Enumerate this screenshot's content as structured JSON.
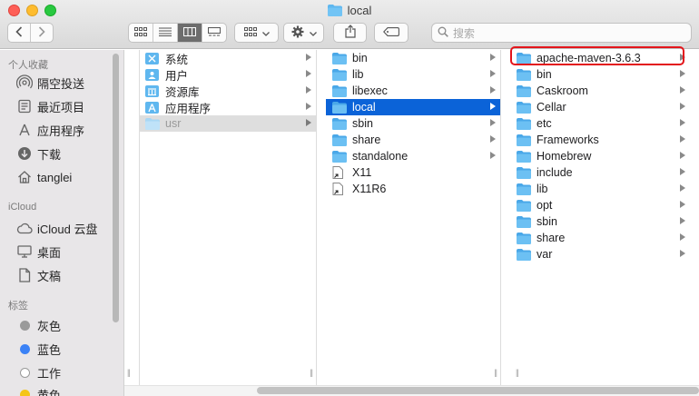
{
  "window": {
    "title": "local"
  },
  "toolbar": {
    "view_modes": [
      "icon-view",
      "list-view",
      "column-view",
      "gallery-view"
    ],
    "active_view": "column-view",
    "search_placeholder": "搜索"
  },
  "sidebar": {
    "sections": [
      {
        "heading": "个人收藏",
        "items": [
          {
            "label": "隔空投送",
            "icon": "airdrop-icon"
          },
          {
            "label": "最近项目",
            "icon": "recents-icon"
          },
          {
            "label": "应用程序",
            "icon": "applications-icon"
          },
          {
            "label": "下载",
            "icon": "downloads-icon"
          },
          {
            "label": "tanglei",
            "icon": "home-icon"
          }
        ]
      },
      {
        "heading": "iCloud",
        "items": [
          {
            "label": "iCloud 云盘",
            "icon": "icloud-icon"
          },
          {
            "label": "桌面",
            "icon": "desktop-icon"
          },
          {
            "label": "文稿",
            "icon": "documents-icon"
          }
        ]
      },
      {
        "heading": "标签",
        "items": [
          {
            "label": "灰色",
            "color": "#9a9a9a"
          },
          {
            "label": "蓝色",
            "color": "#3b82f6"
          },
          {
            "label": "工作",
            "color": "#ffffff"
          },
          {
            "label": "黄色",
            "color": "#f5c518"
          }
        ]
      }
    ]
  },
  "columns": [
    {
      "items": [
        {
          "label": "系统",
          "icon": "system-folder-icon"
        },
        {
          "label": "用户",
          "icon": "users-folder-icon"
        },
        {
          "label": "资源库",
          "icon": "library-folder-icon"
        },
        {
          "label": "应用程序",
          "icon": "applications-folder-icon"
        },
        {
          "label": "usr",
          "icon": "folder-icon",
          "state": "dim"
        }
      ]
    },
    {
      "items": [
        {
          "label": "bin",
          "icon": "folder-icon"
        },
        {
          "label": "lib",
          "icon": "folder-icon"
        },
        {
          "label": "libexec",
          "icon": "folder-icon"
        },
        {
          "label": "local",
          "icon": "folder-icon",
          "state": "selected"
        },
        {
          "label": "sbin",
          "icon": "folder-icon"
        },
        {
          "label": "share",
          "icon": "folder-icon"
        },
        {
          "label": "standalone",
          "icon": "folder-icon"
        },
        {
          "label": "X11",
          "icon": "alias-icon"
        },
        {
          "label": "X11R6",
          "icon": "alias-icon"
        }
      ]
    },
    {
      "items": [
        {
          "label": "apache-maven-3.6.3",
          "icon": "folder-icon",
          "highlighted": true
        },
        {
          "label": "bin",
          "icon": "folder-icon"
        },
        {
          "label": "Caskroom",
          "icon": "folder-icon"
        },
        {
          "label": "Cellar",
          "icon": "folder-icon"
        },
        {
          "label": "etc",
          "icon": "folder-icon"
        },
        {
          "label": "Frameworks",
          "icon": "folder-icon"
        },
        {
          "label": "Homebrew",
          "icon": "folder-icon"
        },
        {
          "label": "include",
          "icon": "folder-icon"
        },
        {
          "label": "lib",
          "icon": "folder-icon"
        },
        {
          "label": "opt",
          "icon": "folder-icon"
        },
        {
          "label": "sbin",
          "icon": "folder-icon"
        },
        {
          "label": "share",
          "icon": "folder-icon"
        },
        {
          "label": "var",
          "icon": "folder-icon"
        }
      ]
    }
  ],
  "colors": {
    "selection": "#0b63d8",
    "folder": "#5fb7ef",
    "annotation": "#e3151b"
  }
}
